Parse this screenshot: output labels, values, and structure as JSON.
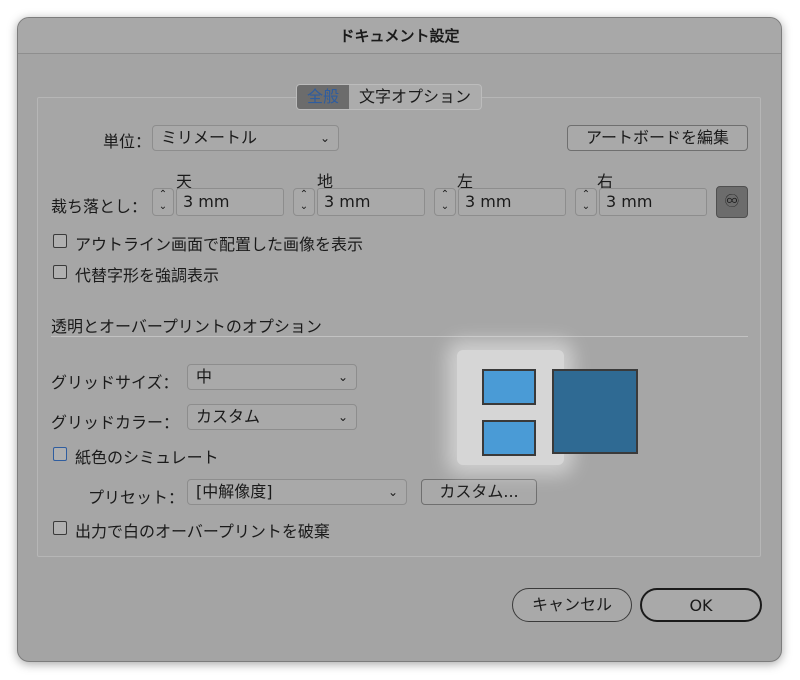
{
  "dialog": {
    "title": "ドキュメント設定"
  },
  "tabs": [
    {
      "label": "全般",
      "active": true
    },
    {
      "label": "文字オプション",
      "active": false
    }
  ],
  "units": {
    "label": "単位：",
    "value": "ミリメートル"
  },
  "artboard_button": "アートボードを編集",
  "bleed": {
    "label": "裁ち落とし：",
    "fields": [
      {
        "label": "天",
        "value": "3 mm"
      },
      {
        "label": "地",
        "value": "3 mm"
      },
      {
        "label": "左",
        "value": "3 mm"
      },
      {
        "label": "右",
        "value": "3 mm"
      }
    ],
    "link_icon": "link-icon"
  },
  "checkboxes": {
    "outline_images": "アウトライン画面で配置した画像を表示",
    "highlight_substituted": "代替字形を強調表示",
    "simulate_paper": "紙色のシミュレート",
    "discard_white_overprint": "出力で白のオーバープリントを破棄"
  },
  "transparency": {
    "section_title": "透明とオーバープリントのオプション",
    "grid_size": {
      "label": "グリッドサイズ：",
      "value": "中"
    },
    "grid_color": {
      "label": "グリッドカラー：",
      "value": "カスタム"
    },
    "preset": {
      "label": "プリセット：",
      "value": "[中解像度]"
    },
    "custom_button": "カスタム..."
  },
  "footer": {
    "cancel": "キャンセル",
    "ok": "OK"
  },
  "colors": {
    "swatch_light": "#4a9bd6",
    "swatch_dark": "#2f6a93",
    "accent_blue": "#2f5d9f"
  }
}
